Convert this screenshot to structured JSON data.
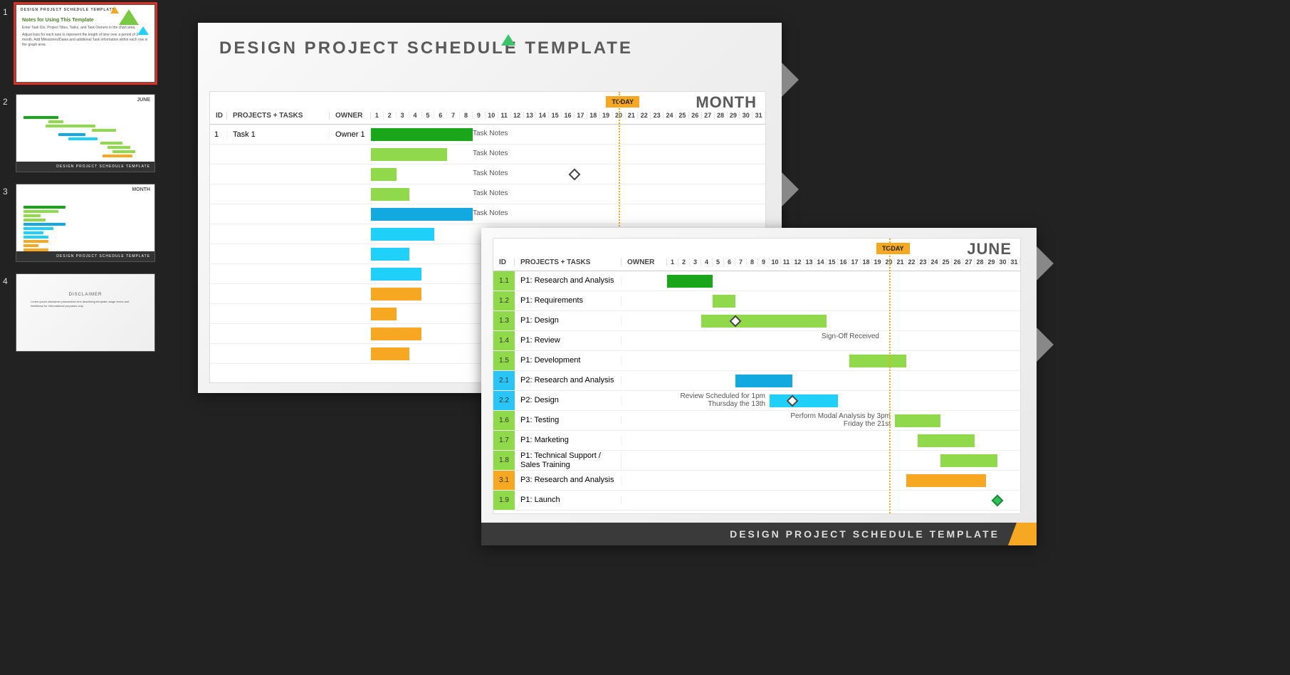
{
  "thumbs": [
    {
      "n": "1",
      "title": "DESIGN PROJECT SCHEDULE TEMPLATE",
      "sub": "Notes for Using This Template",
      "desc1": "Enter Task IDs, Project Titles, Tasks, and Task Owners in the chart area.",
      "desc2": "Adjust bars for each task to represent the length of time over a period of 1 month. Add Milestones/Dates and additional Task information within each row in the graph area."
    },
    {
      "n": "2",
      "title": "JUNE",
      "footer": "DESIGN PROJECT SCHEDULE TEMPLATE"
    },
    {
      "n": "3",
      "title": "MONTH",
      "footer": "DESIGN PROJECT SCHEDULE TEMPLATE"
    },
    {
      "n": "4",
      "title": "DISCLAIMER"
    }
  ],
  "slideBack": {
    "title": "DESIGN PROJECT SCHEDULE TEMPLATE",
    "month": "MONTH",
    "today": "TODAY",
    "days": 31,
    "todayPos": 20,
    "cols": {
      "id": "ID",
      "proj": "PROJECTS + TASKS",
      "own": "OWNER"
    },
    "rows": [
      {
        "id": "1",
        "proj": "Task 1",
        "own": "Owner 1",
        "bar": {
          "s": 1,
          "e": 8,
          "c": "#1aa61a"
        },
        "note": "Task Notes",
        "notePos": 9
      },
      {
        "bar": {
          "s": 1,
          "e": 6,
          "c": "#8fd94a"
        },
        "note": "Task Notes",
        "notePos": 9
      },
      {
        "bar": {
          "s": 1,
          "e": 2,
          "c": "#8fd94a"
        },
        "note": "Task Notes",
        "notePos": 9,
        "diamond": 17
      },
      {
        "bar": {
          "s": 1,
          "e": 3,
          "c": "#8fd94a"
        },
        "note": "Task Notes",
        "notePos": 9
      },
      {
        "bar": {
          "s": 1,
          "e": 8,
          "c": "#12a8e0"
        },
        "note": "Task Notes",
        "notePos": 9
      },
      {
        "bar": {
          "s": 1,
          "e": 5,
          "c": "#1fd1f9"
        }
      },
      {
        "bar": {
          "s": 1,
          "e": 3,
          "c": "#1fd1f9"
        }
      },
      {
        "bar": {
          "s": 1,
          "e": 4,
          "c": "#1fd1f9"
        }
      },
      {
        "bar": {
          "s": 1,
          "e": 4,
          "c": "#f7a823"
        }
      },
      {
        "bar": {
          "s": 1,
          "e": 2,
          "c": "#f7a823"
        }
      },
      {
        "bar": {
          "s": 1,
          "e": 4,
          "c": "#f7a823"
        }
      },
      {
        "bar": {
          "s": 1,
          "e": 3,
          "c": "#f7a823"
        }
      }
    ]
  },
  "slideFront": {
    "month": "JUNE",
    "today": "TODAY",
    "days": 31,
    "todayPos": 20,
    "cols": {
      "id": "ID",
      "proj": "PROJECTS + TASKS",
      "own": "OWNER"
    },
    "footer": "DESIGN PROJECT SCHEDULE TEMPLATE",
    "rows": [
      {
        "id": "1.1",
        "chip": "chip-green",
        "proj": "P1: Research and Analysis",
        "bar": {
          "s": 1,
          "e": 4,
          "c": "#1aa61a"
        }
      },
      {
        "id": "1.2",
        "chip": "chip-green",
        "proj": "P1: Requirements",
        "bar": {
          "s": 5,
          "e": 6,
          "c": "#8fd94a"
        }
      },
      {
        "id": "1.3",
        "chip": "chip-green",
        "proj": "P1: Design",
        "bar": {
          "s": 4,
          "e": 14,
          "c": "#8fd94a"
        },
        "diamond": 7
      },
      {
        "id": "1.4",
        "chip": "chip-green",
        "proj": "P1: Review",
        "note": "Sign-Off Received",
        "notePos": 6,
        "noteAlign": "r"
      },
      {
        "id": "1.5",
        "chip": "chip-green",
        "proj": "P1: Development",
        "bar": {
          "s": 17,
          "e": 21,
          "c": "#8fd94a"
        }
      },
      {
        "id": "2.1",
        "chip": "chip-blue",
        "proj": "P2: Research and Analysis",
        "bar": {
          "s": 7,
          "e": 11,
          "c": "#12a8e0"
        }
      },
      {
        "id": "2.2",
        "chip": "chip-blue",
        "proj": "P2: Design",
        "bar": {
          "s": 10,
          "e": 15,
          "c": "#1fd1f9"
        },
        "diamond": 12,
        "note": "Review Scheduled for 1pm Thursday the 13th",
        "notePos": 1,
        "noteAlign": "r"
      },
      {
        "id": "1.6",
        "chip": "chip-green",
        "proj": "P1: Testing",
        "bar": {
          "s": 21,
          "e": 24,
          "c": "#8fd94a"
        },
        "note": "Perform Modal Analysis by 3pm Friday the 21st",
        "notePos": 6,
        "noteAlign": "r"
      },
      {
        "id": "1.7",
        "chip": "chip-green",
        "proj": "P1: Marketing",
        "bar": {
          "s": 23,
          "e": 27,
          "c": "#8fd94a"
        }
      },
      {
        "id": "1.8",
        "chip": "chip-green",
        "proj": "P1: Technical Support / Sales Training",
        "bar": {
          "s": 25,
          "e": 29,
          "c": "#8fd94a"
        }
      },
      {
        "id": "3.1",
        "chip": "chip-orange",
        "proj": "P3: Research and Analysis",
        "bar": {
          "s": 22,
          "e": 28,
          "c": "#f7a823"
        }
      },
      {
        "id": "1.9",
        "chip": "chip-green",
        "proj": "P1: Launch",
        "diamond": 30,
        "diamondGreen": true
      }
    ]
  }
}
